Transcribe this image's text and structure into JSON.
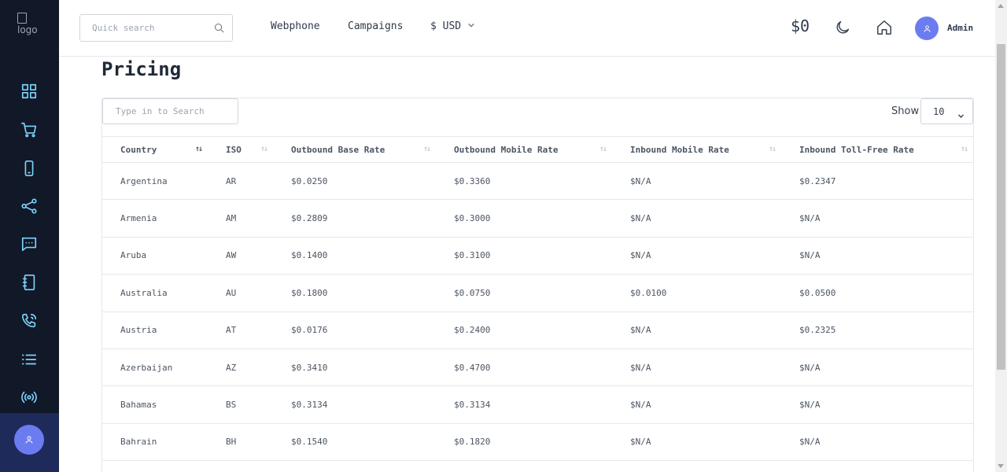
{
  "logo": {
    "alt": "logo"
  },
  "search": {
    "placeholder": "Quick search"
  },
  "nav": {
    "webphone": "Webphone",
    "campaigns": "Campaigns",
    "currency": "$ USD"
  },
  "header": {
    "balance": "$0",
    "user_name": "Admin"
  },
  "sidebar": {
    "icons": [
      "dashboard-icon",
      "cart-icon",
      "phone-device-icon",
      "share-icon",
      "chat-icon",
      "contacts-book-icon",
      "phone-call-icon",
      "list-icon",
      "broadcast-icon"
    ]
  },
  "page": {
    "title": "Pricing"
  },
  "table_controls": {
    "search_placeholder": "Type in to Search",
    "show_label": "Show",
    "show_value": "10"
  },
  "table": {
    "headers": [
      "Country",
      "ISO",
      "Outbound Base Rate",
      "Outbound Mobile Rate",
      "Inbound Mobile Rate",
      "Inbound Toll-Free Rate"
    ],
    "rows": [
      [
        "Argentina",
        "AR",
        "$0.0250",
        "$0.3360",
        "$N/A",
        "$0.2347"
      ],
      [
        "Armenia",
        "AM",
        "$0.2809",
        "$0.3000",
        "$N/A",
        "$N/A"
      ],
      [
        "Aruba",
        "AW",
        "$0.1400",
        "$0.3100",
        "$N/A",
        "$N/A"
      ],
      [
        "Australia",
        "AU",
        "$0.1800",
        "$0.0750",
        "$0.0100",
        "$0.0500"
      ],
      [
        "Austria",
        "AT",
        "$0.0176",
        "$0.2400",
        "$N/A",
        "$0.2325"
      ],
      [
        "Azerbaijan",
        "AZ",
        "$0.3410",
        "$0.4700",
        "$N/A",
        "$N/A"
      ],
      [
        "Bahamas",
        "BS",
        "$0.3134",
        "$0.3134",
        "$N/A",
        "$N/A"
      ],
      [
        "Bahrain",
        "BH",
        "$0.1540",
        "$0.1820",
        "$N/A",
        "$N/A"
      ]
    ]
  },
  "colors": {
    "sidebar_bg": "#111827",
    "accent": "#6b7cf0",
    "icon": "#7dd3fc"
  }
}
